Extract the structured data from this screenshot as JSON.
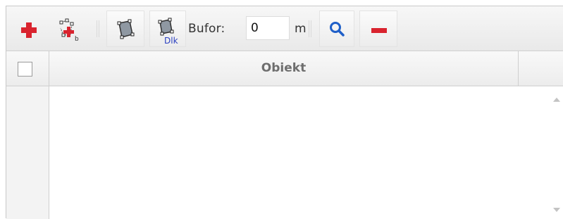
{
  "toolbar": {
    "buttons": [
      {
        "name": "add-object-button",
        "icon": "red-plus-icon"
      },
      {
        "name": "add-by-points-button",
        "icon": "polygon-add-icon"
      },
      {
        "name": "select-polygon-button",
        "icon": "polygon-select-icon"
      },
      {
        "name": "select-polygon-dlk-button",
        "icon": "polygon-dlk-icon",
        "icon_text": "Dlk"
      },
      {
        "name": "search-button",
        "icon": "magnifier-icon"
      },
      {
        "name": "remove-object-button",
        "icon": "red-minus-icon"
      }
    ],
    "bufor_label": "Bufor:",
    "bufor_value": "0",
    "unit_label": "m",
    "accent_red": "#d9232e",
    "accent_blue": "#1f5fc8"
  },
  "table": {
    "select_all_checked": false,
    "columns": [
      {
        "label": "Obiekt"
      }
    ],
    "rows": []
  }
}
